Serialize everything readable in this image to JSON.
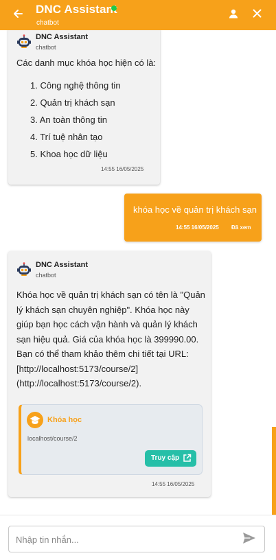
{
  "header": {
    "title": "DNC Assistant",
    "subtitle": "chatbot",
    "online_color": "#21c94a",
    "accent": "#f7a11a"
  },
  "messages": [
    {
      "sender": "DNC Assistant",
      "sender_sub": "chatbot",
      "intro": "Các danh mục khóa học hiện có là:",
      "list": [
        "1. Công nghệ thông tin",
        "2. Quản trị khách sạn",
        "3. An toàn thông tin",
        "4. Trí tuệ nhân tạo",
        "5. Khoa học dữ liệu"
      ],
      "time": "14:55 16/05/2025"
    },
    {
      "text": "khóa học về quản trị khách sạn",
      "time": "14:55 16/05/2025",
      "status": "Đã xem"
    },
    {
      "sender": "DNC Assistant",
      "sender_sub": "chatbot",
      "lines": [
        "Khóa học về quản trị khách sạn có tên là \"Quản",
        "lý khách sạn chuyên nghiệp\". Khóa học này",
        "giúp bạn học cách vận hành và quản lý khách",
        "sạn hiệu quả. Giá của khóa học là 399990.00.",
        "Bạn có thể tham khảo thêm chi tiết tại URL:",
        "[http://localhost:5173/course/2]",
        "(http://localhost:5173/course/2)."
      ],
      "card": {
        "title": "Khóa học",
        "url": "localhost/course/2",
        "button": "Truy cập",
        "button_color": "#26bfa8"
      },
      "time": "14:55 16/05/2025"
    }
  ],
  "input": {
    "placeholder": "Nhập tin nhắn..."
  },
  "icons": {
    "back": "arrow-left-icon",
    "user": "person-icon",
    "close": "close-icon",
    "avatar": "robot-icon",
    "course": "graduation-cap-icon",
    "external": "external-link-icon",
    "send": "send-icon"
  }
}
